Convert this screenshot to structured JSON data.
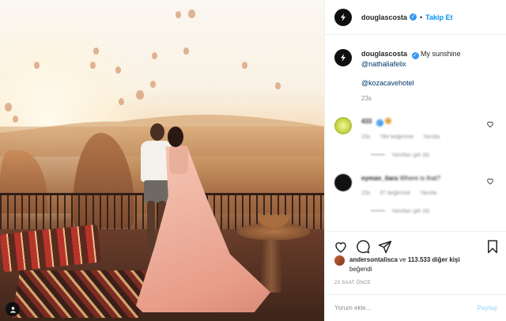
{
  "post": {
    "username": "douglascosta",
    "follow_label": "Takip Et",
    "dot": "•",
    "caption": {
      "username": "douglascosta",
      "text": "My sunshine",
      "mention": "@nathaliafelix",
      "mention2": "@kozacavehotel",
      "time": "23s"
    },
    "comments": [
      {
        "user": "433",
        "text": "",
        "time": "23s",
        "likes": "784 beğenme",
        "reply": "Yanıtla",
        "view_replies": "Yanıtları gör (8)",
        "avatar_color": "#c9d84a"
      },
      {
        "user": "eyman_ilara",
        "text": "Where is that?",
        "time": "23s",
        "likes": "37 beğenme",
        "reply": "Yanıtla",
        "view_replies": "Yanıtları gör (9)",
        "avatar_color": "#111111"
      }
    ],
    "likes": {
      "user": "andersontalisca",
      "connector": "ve",
      "count": "113.533 diğer kişi",
      "suffix": "beğendi"
    },
    "posted_time": "23 SAAT ÖNCE",
    "add_comment": {
      "placeholder": "Yorum ekle...",
      "post_label": "Paylaş"
    }
  },
  "icons": {
    "like": "heart-icon",
    "comment": "comment-icon",
    "share": "paper-plane-icon",
    "save": "bookmark-icon",
    "verified": "verified-badge-icon"
  },
  "colors": {
    "accent": "#0095f6",
    "verified": "#3897f0",
    "muted": "#8e8e8e"
  }
}
